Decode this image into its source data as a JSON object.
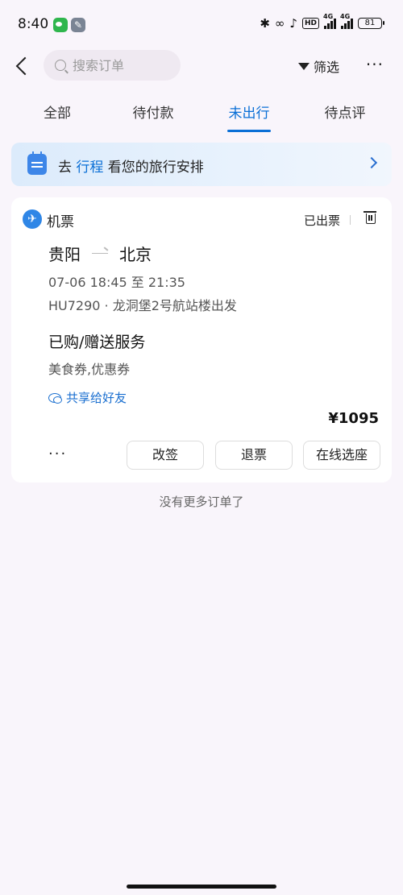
{
  "status_bar": {
    "time": "8:40",
    "network1": "4G",
    "network2": "4G",
    "hd": "HD",
    "battery": "81"
  },
  "header": {
    "search_placeholder": "搜索订单",
    "filter_label": "筛选",
    "more_label": "···"
  },
  "tabs": [
    {
      "label": "全部",
      "active": false
    },
    {
      "label": "待付款",
      "active": false
    },
    {
      "label": "未出行",
      "active": true
    },
    {
      "label": "待点评",
      "active": false
    }
  ],
  "banner": {
    "prefix": "去 ",
    "link": "行程",
    "suffix": " 看您的旅行安排"
  },
  "order": {
    "type": "机票",
    "status": "已出票",
    "from": "贵阳",
    "to": "北京",
    "time": "07-06 18:45 至 21:35",
    "info": "HU7290 · 龙洞堡2号航站楼出发",
    "service_title": "已购/赠送服务",
    "service_detail": "美食券,优惠券",
    "share_label": "共享给好友",
    "price": "¥1095",
    "more_label": "···",
    "actions": [
      "改签",
      "退票",
      "在线选座"
    ]
  },
  "footer_note": "没有更多订单了",
  "colors": {
    "accent": "#0a6fd6",
    "background": "#f9f5fb"
  }
}
